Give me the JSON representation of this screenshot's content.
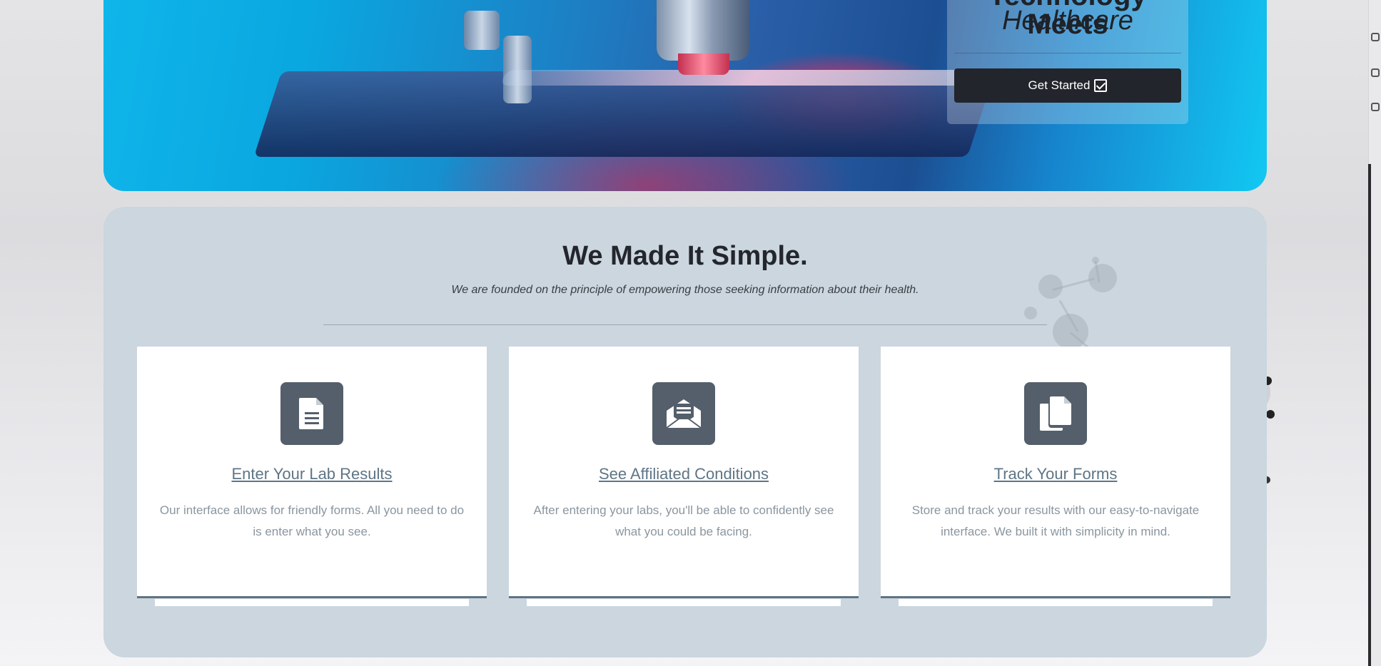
{
  "hero": {
    "title_line1": "Technology Meets",
    "title_line2": "Healthcare",
    "cta_label": "Get Started"
  },
  "section": {
    "title": "We Made It Simple.",
    "subtitle": "We are founded on the principle of empowering those seeking information about their health."
  },
  "cards": [
    {
      "icon": "document-icon",
      "title": "Enter Your Lab Results",
      "text": "Our interface allows for friendly forms. All you need to do is enter what you see."
    },
    {
      "icon": "envelope-open-icon",
      "title": "See Affiliated Conditions",
      "text": "After entering your labs, you'll be able to confidently see what you could be facing."
    },
    {
      "icon": "copy-documents-icon",
      "title": "Track Your Forms",
      "text": "Store and track your results with our easy-to-navigate interface. We built it with simplicity in mind."
    }
  ],
  "colors": {
    "section_bg": "#cbd6df",
    "button_bg": "#22252b",
    "icon_tile": "#545f6b",
    "card_link": "#5f7585"
  }
}
